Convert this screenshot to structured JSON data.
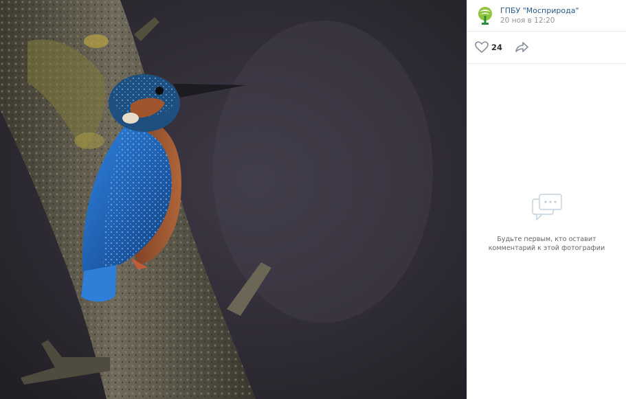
{
  "post": {
    "author": "ГПБУ \"Мосприрода\"",
    "date": "20 ноя в 12:20",
    "likes": "24"
  },
  "comments": {
    "empty_line1": "Будьте первым, кто оставит",
    "empty_line2": "комментарий к этой фотографии"
  },
  "icons": {
    "avatar": "mospriroda-logo-icon",
    "like": "heart-icon",
    "share": "share-arrow-icon",
    "comments": "comment-bubbles-icon"
  },
  "colors": {
    "link": "#2a5885",
    "muted": "#939393",
    "divider": "#e7e8ec",
    "kingfisher_blue": "#2f7fd9",
    "kingfisher_orange": "#a0552e"
  }
}
